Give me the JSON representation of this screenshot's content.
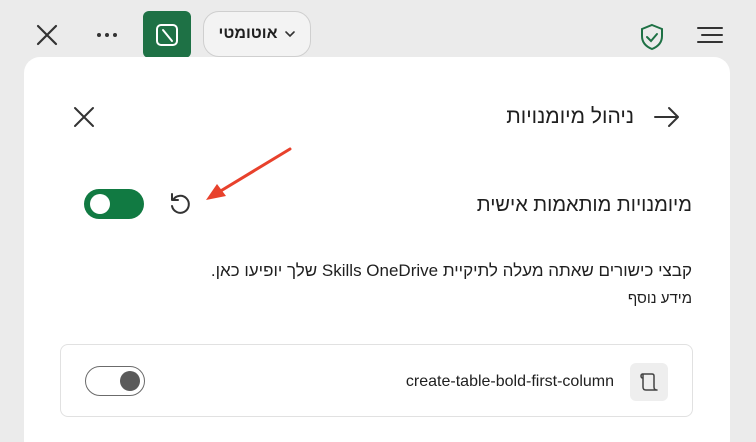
{
  "toolbar": {
    "auto_label": "אוטומטי",
    "icons": [
      "close-icon",
      "more-icon",
      "app-icon",
      "chevron-down-icon",
      "shield-icon",
      "menu-icon"
    ],
    "app_color": "#1e7145"
  },
  "panel": {
    "title": "ניהול מיומנויות",
    "custom_skills_label": "מיומנויות מותאמות אישית",
    "custom_skills_enabled": true,
    "description": "קבצי כישורים שאתה מעלה לתיקיית Skills OneDrive שלך יופיעו כאן.",
    "more_info": "מידע נוסף",
    "skills": [
      {
        "name": "create-table-bold-first-column",
        "enabled": false
      }
    ]
  },
  "colors": {
    "toggle_on": "#117a42",
    "annotation_arrow": "#e8412c"
  }
}
